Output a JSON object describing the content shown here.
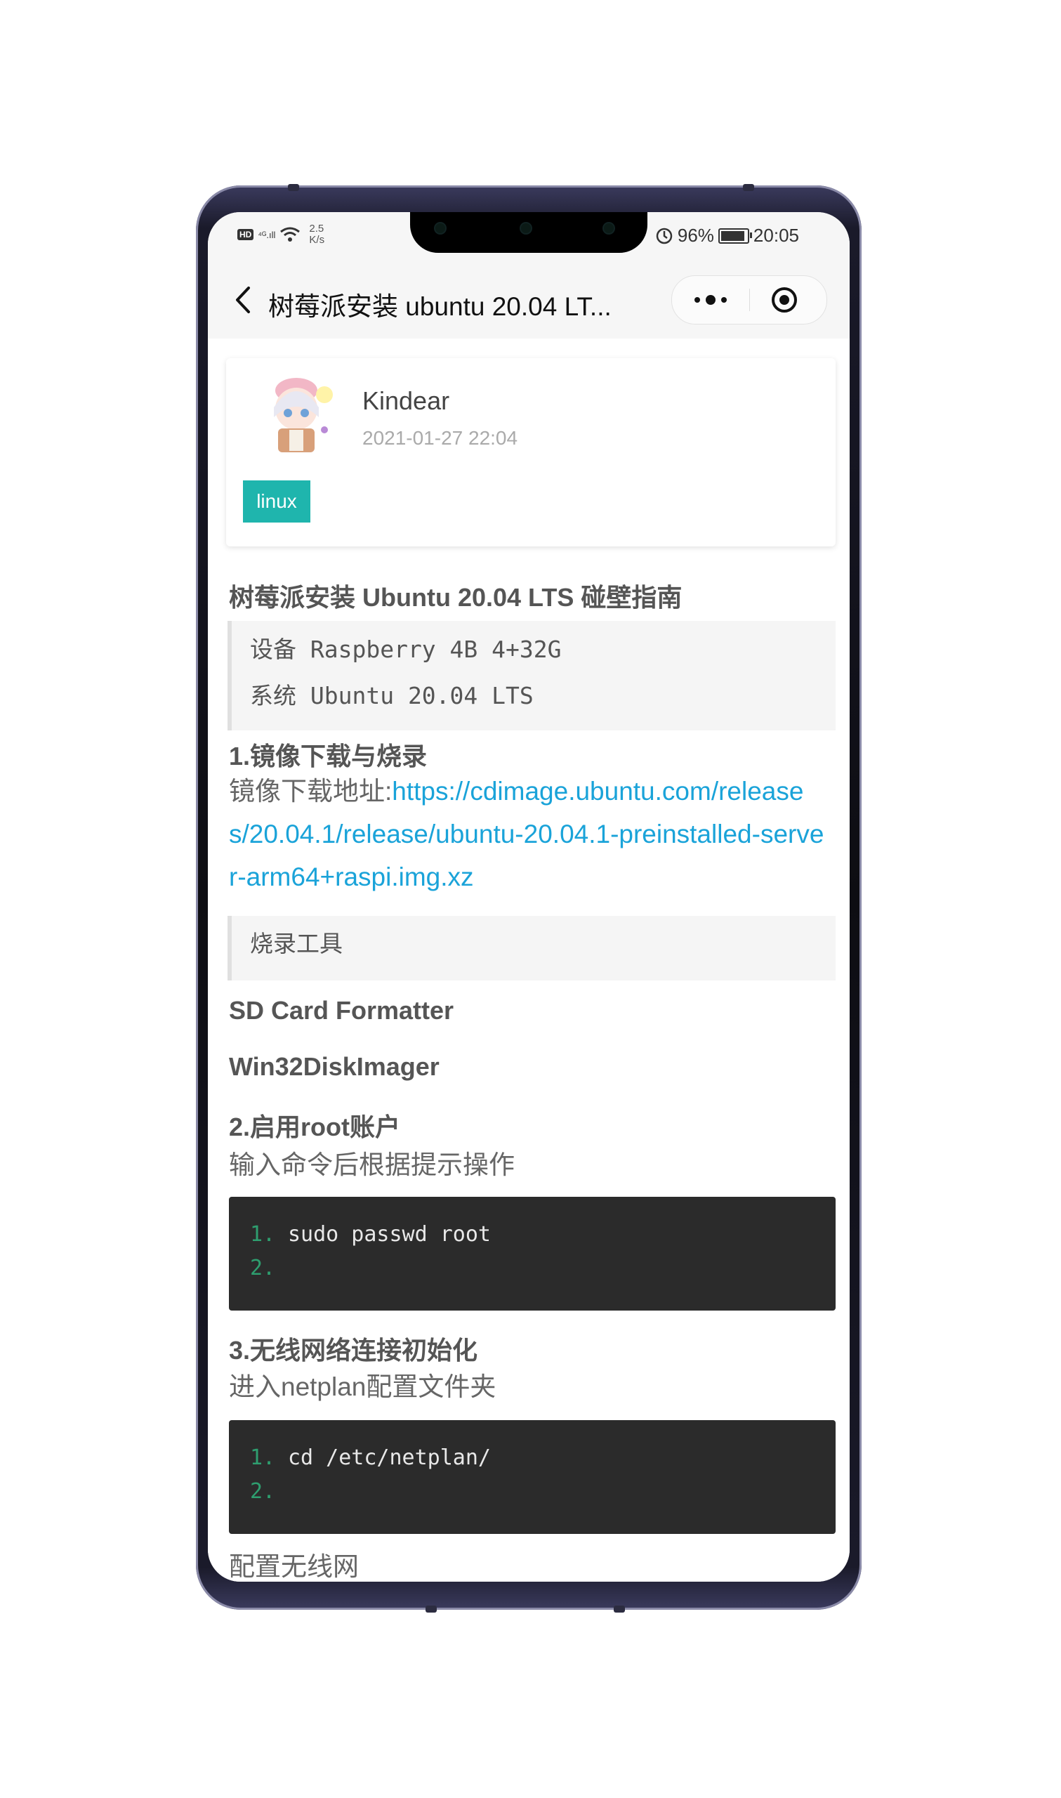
{
  "status_bar": {
    "hd": "HD",
    "signal": "⁴ᴳ.ıll",
    "speed_value": "2.5",
    "speed_unit": "K/s",
    "battery": "96%",
    "time": "20:05"
  },
  "nav": {
    "title": "树莓派安装 ubuntu 20.04 LT..."
  },
  "post_meta": {
    "author": "Kindear",
    "date": "2021-01-27 22:04",
    "tag": "linux"
  },
  "article": {
    "title": "树莓派安装 Ubuntu 20.04 LTS 碰壁指南",
    "info_quote": [
      "设备 Raspberry 4B 4+32G",
      "系统 Ubuntu 20.04 LTS"
    ],
    "section1": {
      "heading": "1.镜像下载与烧录",
      "download_label": "镜像下载地址:",
      "download_url_line1": "https://cdimage.ubuntu.com/release",
      "download_url_line2": "s/20.04.1/release/ubuntu-20.04.1-preinstalled-serve",
      "download_url_line3": "r-arm64+raspi.img.xz",
      "tools_quote": "烧录工具",
      "tool1": "SD Card Formatter",
      "tool2": "Win32DiskImager"
    },
    "section2": {
      "heading": "2.启用root账户",
      "desc": "输入命令后根据提示操作",
      "code": [
        {
          "num": "1.",
          "text": "sudo passwd root"
        },
        {
          "num": "2.",
          "text": ""
        }
      ]
    },
    "section3": {
      "heading": "3.无线网络连接初始化",
      "desc": "进入netplan配置文件夹",
      "code": [
        {
          "num": "1.",
          "text": "cd /etc/netplan/"
        },
        {
          "num": "2.",
          "text": ""
        }
      ],
      "next_text": "配置无线网"
    }
  },
  "colors": {
    "tag_bg": "#1fb5ad",
    "link": "#1aa3d9",
    "code_bg": "#2b2b2b",
    "line_number": "#2e9e6f"
  }
}
